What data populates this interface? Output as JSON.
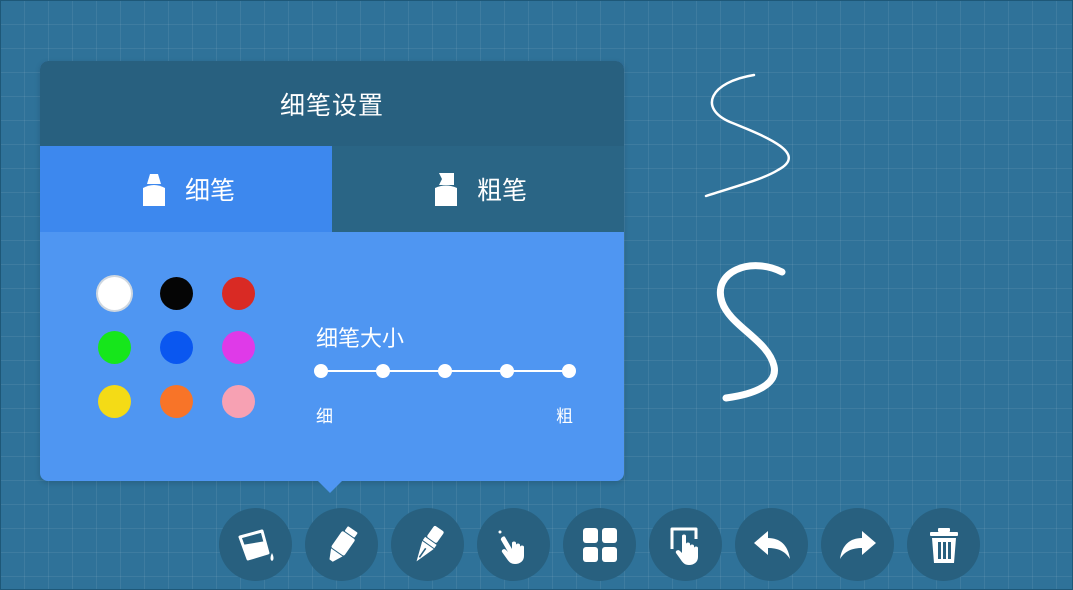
{
  "panel": {
    "title": "细笔设置",
    "tabs": [
      {
        "id": "fine",
        "label": "细笔",
        "active": true
      },
      {
        "id": "thick",
        "label": "粗笔",
        "active": false
      }
    ],
    "colors": [
      {
        "name": "white",
        "hex": "#ffffff",
        "selected": true
      },
      {
        "name": "black",
        "hex": "#050505",
        "selected": false
      },
      {
        "name": "red",
        "hex": "#d92a24",
        "selected": false
      },
      {
        "name": "green",
        "hex": "#16e61b",
        "selected": false
      },
      {
        "name": "blue",
        "hex": "#0a57f0",
        "selected": false
      },
      {
        "name": "magenta",
        "hex": "#df3ae8",
        "selected": false
      },
      {
        "name": "yellow",
        "hex": "#f4db16",
        "selected": false
      },
      {
        "name": "orange",
        "hex": "#f87428",
        "selected": false
      },
      {
        "name": "pink",
        "hex": "#f7a1b3",
        "selected": false
      }
    ],
    "size": {
      "label": "细笔大小",
      "min_label": "细",
      "max_label": "粗",
      "levels": 5
    }
  },
  "toolbar": {
    "tools": [
      {
        "name": "fill-bucket-icon"
      },
      {
        "name": "marker-icon",
        "active": true
      },
      {
        "name": "fountain-pen-icon"
      },
      {
        "name": "pointer-hand-icon"
      },
      {
        "name": "grid-icon"
      },
      {
        "name": "touch-select-icon"
      },
      {
        "name": "undo-icon"
      },
      {
        "name": "redo-icon"
      },
      {
        "name": "trash-icon"
      }
    ]
  },
  "colors": {
    "background": "#2f7299",
    "panel_header": "#28607f",
    "panel_body": "#4f96f2",
    "tab_active": "#3d88ee",
    "tab_inactive": "#2a6585",
    "toolbar_button": "#28607f"
  }
}
